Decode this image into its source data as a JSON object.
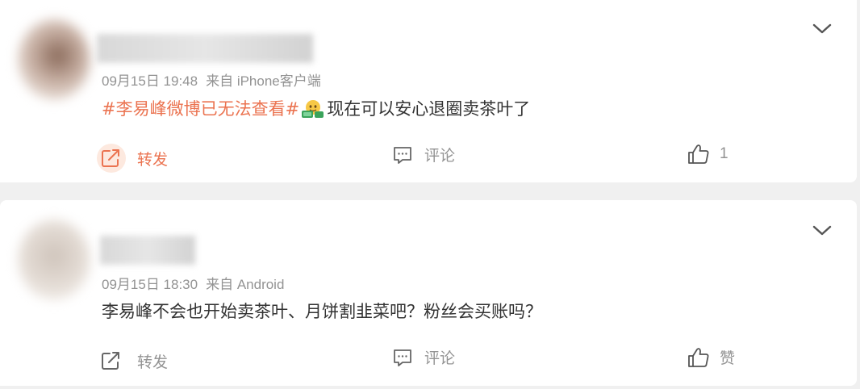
{
  "posts": [
    {
      "meta_time": "09月15日 19:48",
      "meta_source": "来自 iPhone客户端",
      "topic": "#李易峰微博已无法查看#",
      "text": "现在可以安心退圈卖茶叶了",
      "emoji_icon": "money-mouth-emoji-icon",
      "repost_label": "转发",
      "comment_label": "评论",
      "like_label": "1",
      "repost_active": true
    },
    {
      "meta_time": "09月15日 18:30",
      "meta_source": "来自 Android",
      "text": "李易峰不会也开始卖茶叶、月饼割韭菜吧？粉丝会买账吗？",
      "repost_label": "转发",
      "comment_label": "评论",
      "like_label": "赞",
      "repost_active": false
    }
  ],
  "colors": {
    "accent": "#eb7350",
    "meta": "#939393",
    "text": "#333333",
    "background": "#f0f0f0"
  }
}
